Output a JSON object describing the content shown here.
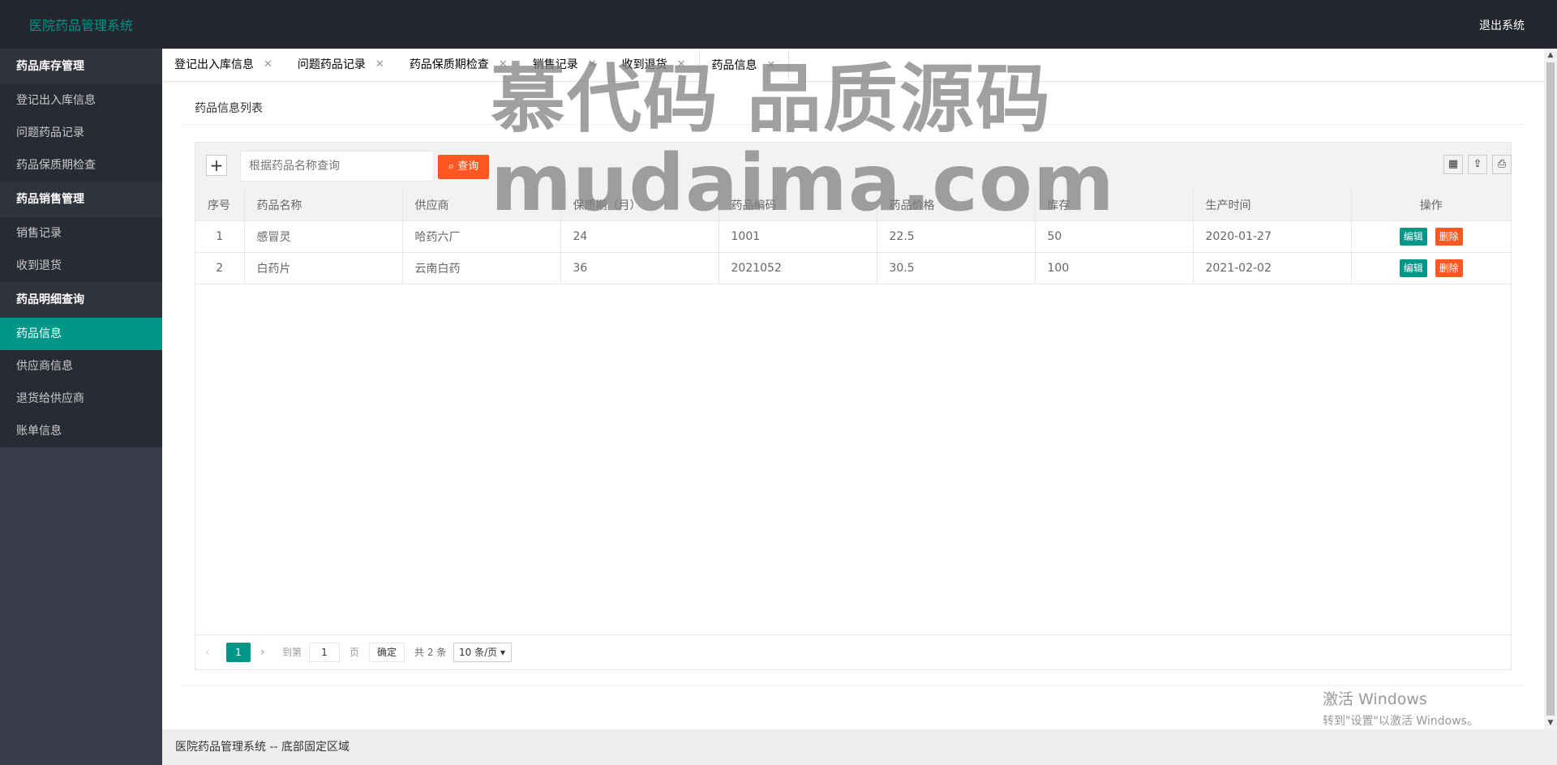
{
  "app": {
    "title": "医院药品管理系统",
    "logout": "退出系统"
  },
  "sidebar": {
    "groups": [
      {
        "title": "药品库存管理",
        "items": [
          "登记出入库信息",
          "问题药品记录",
          "药品保质期检查"
        ]
      },
      {
        "title": "药品销售管理",
        "items": [
          "销售记录",
          "收到退货"
        ]
      },
      {
        "title": "药品明细查询",
        "items": [
          "药品信息",
          "供应商信息",
          "退货给供应商",
          "账单信息"
        ]
      }
    ],
    "active_item": "药品信息"
  },
  "tabs": [
    "登记出入库信息",
    "问题药品记录",
    "药品保质期检查",
    "销售记录",
    "收到退货",
    "药品信息"
  ],
  "active_tab": "药品信息",
  "card": {
    "title": "药品信息列表"
  },
  "toolbar": {
    "add_label": "+",
    "search_placeholder": "根据药品名称查询",
    "search_button": "查询",
    "icons": [
      "columns-icon",
      "export-icon",
      "print-icon"
    ]
  },
  "table": {
    "headers": [
      "序号",
      "药品名称",
      "供应商",
      "保质期（月）",
      "药品编码",
      "药品价格",
      "库存",
      "生产时间",
      "操作"
    ],
    "rows": [
      [
        "1",
        "感冒灵",
        "哈药六厂",
        "24",
        "1001",
        "22.5",
        "50",
        "2020-01-27"
      ],
      [
        "2",
        "白药片",
        "云南白药",
        "36",
        "2021052",
        "30.5",
        "100",
        "2021-02-02"
      ]
    ],
    "edit_label": "编辑",
    "delete_label": "删除"
  },
  "pager": {
    "current": "1",
    "goto_label": "到第",
    "goto_value": "1",
    "page_label": "页",
    "ok_label": "确定",
    "total": "共 2 条",
    "page_size": "10 条/页"
  },
  "footer": "医院药品管理系统 -- 底部固定区域",
  "watermark": {
    "line1": "慕代码 品质源码",
    "line2": "mudaima.com"
  },
  "activation": {
    "line1": "激活 Windows",
    "line2": "转到\"设置\"以激活 Windows。"
  },
  "colors": {
    "primary": "#009688",
    "danger": "#ff5722",
    "header_bg": "#23262e",
    "sidebar_bg": "#393d49"
  }
}
